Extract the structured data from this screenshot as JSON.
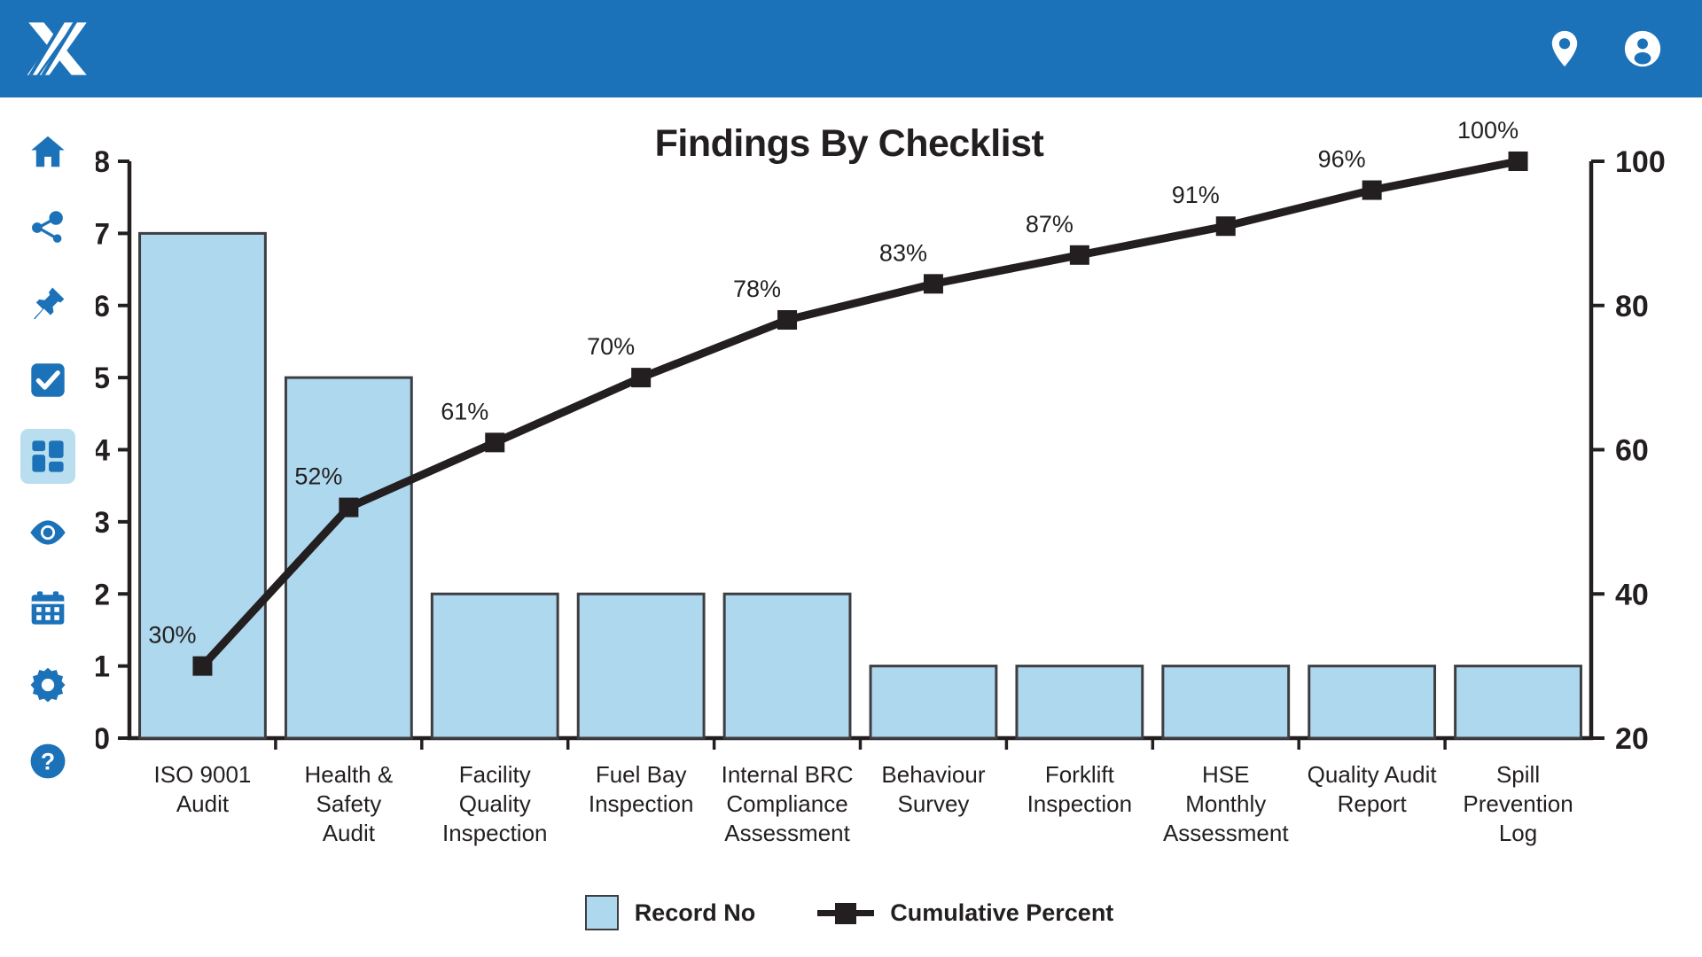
{
  "header": {
    "logo_name": "logo-x-mark",
    "brand_color": "#1c72b8",
    "actions": [
      {
        "name": "location-pin-icon",
        "label": "Location"
      },
      {
        "name": "user-account-icon",
        "label": "Account"
      }
    ]
  },
  "sidebar": {
    "items": [
      {
        "name": "sidebar-item-home",
        "icon": "home-icon",
        "label": "Home",
        "active": false
      },
      {
        "name": "sidebar-item-share",
        "icon": "share-icon",
        "label": "Share",
        "active": false
      },
      {
        "name": "sidebar-item-pin",
        "icon": "pin-icon",
        "label": "Pinned",
        "active": false
      },
      {
        "name": "sidebar-item-tasks",
        "icon": "checkbox-icon",
        "label": "Tasks",
        "active": false
      },
      {
        "name": "sidebar-item-dashboard",
        "icon": "dashboard-icon",
        "label": "Dashboard",
        "active": true
      },
      {
        "name": "sidebar-item-observations",
        "icon": "eye-icon",
        "label": "Observations",
        "active": false
      },
      {
        "name": "sidebar-item-calendar",
        "icon": "calendar-icon",
        "label": "Calendar",
        "active": false
      },
      {
        "name": "sidebar-item-settings",
        "icon": "gear-icon",
        "label": "Settings",
        "active": false
      },
      {
        "name": "sidebar-item-help",
        "icon": "help-icon",
        "label": "Help",
        "active": false
      }
    ],
    "active_bg": "#b9deef",
    "icon_color": "#1c72b8"
  },
  "chart_data": {
    "type": "bar",
    "title": "Findings By Checklist",
    "xlabel": "",
    "ylabel": "",
    "grid": false,
    "legend_position": "bottom",
    "categories": [
      "ISO 9001 Audit",
      "Health & Safety Audit",
      "Facility Quality Inspection",
      "Fuel Bay Inspection",
      "Internal BRC Compliance Assessment",
      "Behaviour Survey",
      "Forklift Inspection",
      "HSE Monthly Assessment",
      "Quality Audit Report",
      "Spill Prevention Log"
    ],
    "category_lines": [
      [
        "ISO 9001",
        "Audit"
      ],
      [
        "Health &",
        "Safety",
        "Audit"
      ],
      [
        "Facility",
        "Quality",
        "Inspection"
      ],
      [
        "Fuel Bay",
        "Inspection"
      ],
      [
        "Internal BRC",
        "Compliance",
        "Assessment"
      ],
      [
        "Behaviour",
        "Survey"
      ],
      [
        "Forklift",
        "Inspection"
      ],
      [
        "HSE",
        "Monthly",
        "Assessment"
      ],
      [
        "Quality Audit",
        "Report"
      ],
      [
        "Spill",
        "Prevention",
        "Log"
      ]
    ],
    "series": [
      {
        "name": "Record No",
        "kind": "bar",
        "color": "#aed8ee",
        "edge_color": "#3e3e42",
        "axis": "left",
        "values": [
          7,
          5,
          2,
          2,
          2,
          1,
          1,
          1,
          1,
          1
        ]
      },
      {
        "name": "Cumulative Percent",
        "kind": "line",
        "color": "#231f20",
        "axis": "right",
        "values": [
          30,
          52,
          61,
          70,
          78,
          83,
          87,
          91,
          96,
          100
        ],
        "labels": [
          "30%",
          "52%",
          "61%",
          "70%",
          "78%",
          "83%",
          "87%",
          "91%",
          "96%",
          "100%"
        ]
      }
    ],
    "y_left": {
      "min": 0,
      "max": 8,
      "ticks": [
        0,
        1,
        2,
        3,
        4,
        5,
        6,
        7,
        8
      ]
    },
    "y_right": {
      "min": 20,
      "max": 100,
      "ticks": [
        20,
        40,
        60,
        80,
        100
      ]
    }
  },
  "legend": {
    "entries": [
      {
        "name": "legend-record-no",
        "label": "Record No"
      },
      {
        "name": "legend-cumulative-percent",
        "label": "Cumulative Percent"
      }
    ]
  }
}
